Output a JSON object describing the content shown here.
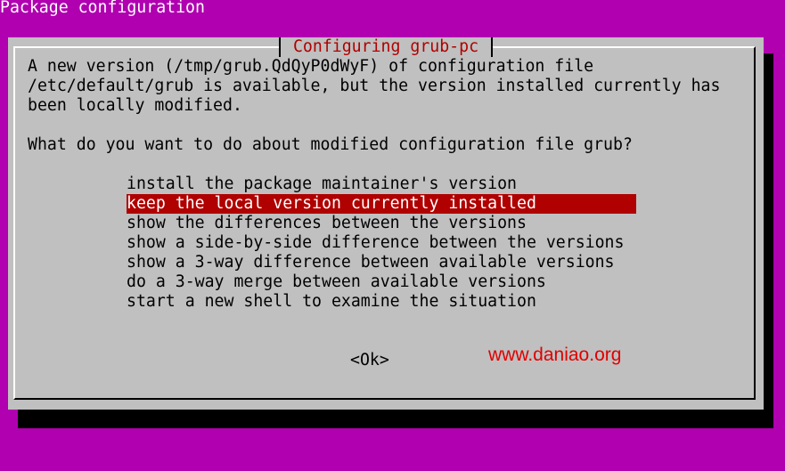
{
  "window": {
    "title": "Package configuration"
  },
  "dialog": {
    "title": "Configuring grub-pc",
    "description": [
      "A new version (/tmp/grub.QdQyP0dWyF) of configuration file",
      "/etc/default/grub is available, but the version installed currently has",
      "been locally modified."
    ],
    "question": "What do you want to do about modified configuration file grub?",
    "choices": [
      "install the package maintainer's version",
      "keep the local version currently installed",
      "show the differences between the versions",
      "show a side-by-side difference between the versions",
      "show a 3-way difference between available versions",
      "do a 3-way merge between available versions",
      "start a new shell to examine the situation"
    ],
    "selected_index": 1,
    "ok_label": "<Ok>"
  },
  "watermark": {
    "text": "www.daniao.org"
  },
  "colors": {
    "background": "#b000b0",
    "dialog": "#c0c0c0",
    "highlight": "#b00000",
    "watermark": "#e00000"
  }
}
